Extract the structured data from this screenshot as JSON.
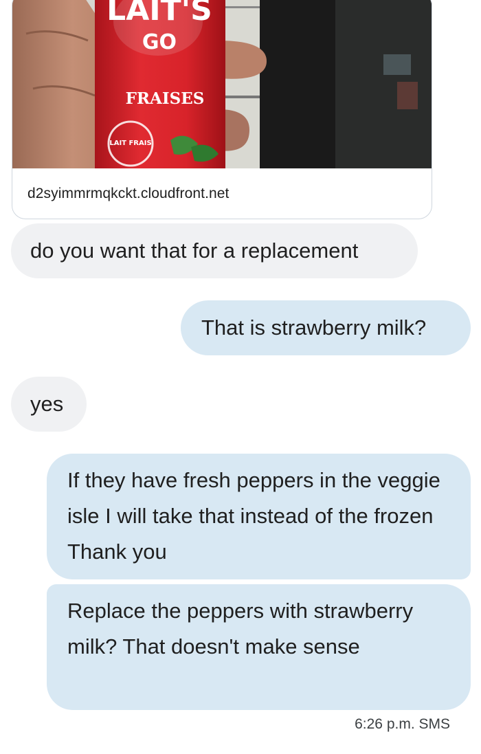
{
  "link_preview": {
    "image_alt": "Lait's Go Fraises strawberry milk bottle held in a hand",
    "image_text": {
      "brand": "LAIT'S",
      "line2": "GO",
      "flavor": "FRAISES",
      "badge": "LAIT FRAIS"
    },
    "domain": "d2syimmrmqkckt.cloudfront.net"
  },
  "messages": [
    {
      "direction": "incoming",
      "text": "do you want that for a replacement"
    },
    {
      "direction": "outgoing",
      "text": "That is strawberry milk?"
    },
    {
      "direction": "incoming",
      "text": "yes"
    },
    {
      "direction": "outgoing",
      "text": "If they have fresh peppers in the veggie isle I will take that instead of the frozen Thank you"
    },
    {
      "direction": "outgoing",
      "text": "Replace the peppers with strawberry milk? That doesn't make sense"
    }
  ],
  "status": {
    "timestamp": "6:26 p.m. SMS"
  },
  "colors": {
    "incoming_bubble": "#f0f1f3",
    "outgoing_bubble": "#d8e8f3",
    "bottle_red": "#d8232a"
  }
}
